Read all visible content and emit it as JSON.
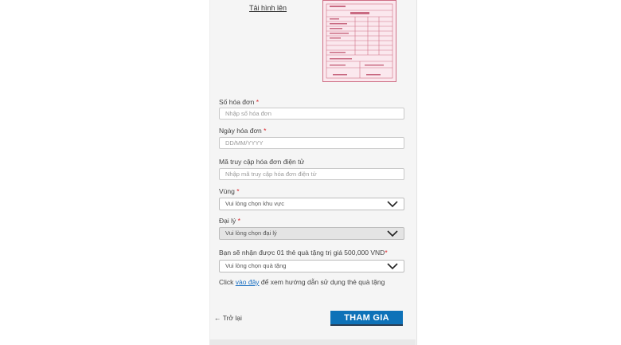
{
  "upload": {
    "link_label": "Tải hình lên"
  },
  "form": {
    "invoice_number": {
      "label": "Số hóa đơn",
      "required_mark": "*",
      "placeholder": "Nhập số hóa đơn"
    },
    "invoice_date": {
      "label": "Ngày hóa đơn",
      "required_mark": "*",
      "placeholder": "DD/MM/YYYY"
    },
    "access_code": {
      "label": "Mã truy cập hóa đơn điện tử",
      "placeholder": "Nhập mã truy cập hóa đơn điện tử"
    },
    "region": {
      "label": "Vùng",
      "required_mark": "*",
      "selected": "Vui lòng chọn khu vực"
    },
    "dealer": {
      "label": "Đại lý",
      "required_mark": "*",
      "selected": "Vui lòng chọn đại lý"
    },
    "gift": {
      "label": "Bạn sẽ nhận được 01 thẻ quà tặng trị giá 500,000 VND",
      "required_mark": "*",
      "selected": "Vui lòng chọn quà tặng"
    },
    "help": {
      "prefix": "Click ",
      "link": "vào đây",
      "suffix": " để xem hướng dẫn sử dụng thẻ quà tặng"
    }
  },
  "actions": {
    "back_label": "← Trở lại",
    "submit_label": "THAM GIA"
  },
  "colors": {
    "accent": "#0e72b8",
    "required": "#d9252c",
    "link": "#1a6fc2",
    "invoice_pink": "#cf6f86"
  }
}
